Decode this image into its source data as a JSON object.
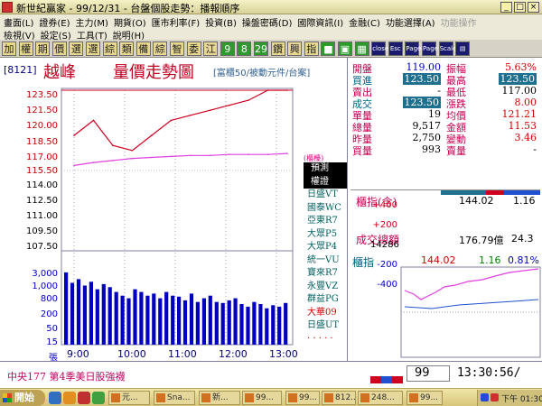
{
  "title": {
    "text": "新世紀贏家 - 99/12/31 - 台盤個股走勢：播報順序",
    "buttons": [
      "_",
      "□",
      "×"
    ]
  },
  "menu_row1": [
    {
      "label": "畫面(L)",
      "enabled": true
    },
    {
      "label": "證券(E)",
      "enabled": true
    },
    {
      "label": "主力(M)",
      "enabled": true
    },
    {
      "label": "期貨(O)",
      "enabled": true
    },
    {
      "label": "匯市利率(F)",
      "enabled": true
    },
    {
      "label": "投資(B)",
      "enabled": true
    },
    {
      "label": "操盤密碼(D)",
      "enabled": true
    },
    {
      "label": "國際資訊(I)",
      "enabled": true
    },
    {
      "label": "金融(C)",
      "enabled": true
    },
    {
      "label": "功能選擇(A)",
      "enabled": true
    },
    {
      "label": "功能操作",
      "enabled": false
    }
  ],
  "menu_row2": [
    {
      "label": "檢視(V)",
      "enabled": true
    },
    {
      "label": "設定(S)",
      "enabled": true
    },
    {
      "label": "工具(T)",
      "enabled": true
    },
    {
      "label": "說明(H)",
      "enabled": true
    }
  ],
  "toolbar": [
    {
      "label": "加",
      "style": "y"
    },
    {
      "label": "權",
      "style": "y"
    },
    {
      "label": "期",
      "style": "y"
    },
    {
      "label": "價",
      "style": "y"
    },
    {
      "label": "選",
      "style": "y"
    },
    {
      "label": "選",
      "style": "y"
    },
    {
      "label": "綜",
      "style": "y"
    },
    {
      "label": "類",
      "style": "y"
    },
    {
      "label": "備",
      "style": "y"
    },
    {
      "label": "綜",
      "style": "y"
    },
    {
      "label": "智",
      "style": "y"
    },
    {
      "label": "委",
      "style": "y"
    },
    {
      "label": "江",
      "style": "y"
    },
    {
      "label": "9",
      "style": "g"
    },
    {
      "label": "8",
      "style": "g"
    },
    {
      "label": "29",
      "style": "g"
    },
    {
      "label": "鑽",
      "style": "y"
    },
    {
      "label": "興",
      "style": "y"
    },
    {
      "label": "指",
      "style": "y"
    },
    {
      "label": "■",
      "style": "g"
    },
    {
      "label": "▣",
      "style": "g"
    },
    {
      "label": "▦",
      "style": "g"
    },
    {
      "label": "close",
      "style": "d"
    },
    {
      "label": "Esc",
      "style": "d"
    },
    {
      "label": "Page",
      "style": "d"
    },
    {
      "label": "Page",
      "style": "d"
    },
    {
      "label": "Scale",
      "style": "d"
    },
    {
      "label": "▤",
      "style": "d"
    }
  ],
  "header": {
    "code": "[8121]",
    "name": "越峰",
    "title": "量價走勢圖",
    "category": "[富櫃50/被動元件/台案]"
  },
  "price_axis": [
    "123.50",
    "121.50",
    "120.00",
    "118.50",
    "117.00",
    "115.50",
    "114.00",
    "112.50",
    "111.00",
    "109.50",
    "107.50"
  ],
  "volume_axis": [
    "3,000",
    "1,000",
    "800",
    "200",
    "50",
    "15",
    "張"
  ],
  "time_axis": [
    "9:00",
    "10:00",
    "11:00",
    "12:00",
    "13:00"
  ],
  "legend": {
    "note": "(櫃檯)",
    "items": [
      {
        "label": "預測",
        "style": "hl"
      },
      {
        "label": "權證",
        "style": "hl"
      },
      {
        "label": "日盛VT",
        "style": "normal"
      },
      {
        "label": "國泰WC",
        "style": "normal"
      },
      {
        "label": "亞東R7",
        "style": "normal"
      },
      {
        "label": "大眾P5",
        "style": "normal"
      },
      {
        "label": "大眾P4",
        "style": "normal"
      },
      {
        "label": "統一VU",
        "style": "normal"
      },
      {
        "label": "寶來R7",
        "style": "normal"
      },
      {
        "label": "永豐VZ",
        "style": "normal"
      },
      {
        "label": "群益PG",
        "style": "normal"
      },
      {
        "label": "大華09",
        "style": "red"
      },
      {
        "label": "日盛UT",
        "style": "normal"
      },
      {
        "label": "· · · · ·",
        "style": "red"
      }
    ]
  },
  "quote": {
    "rows": [
      {
        "l1": "開盤",
        "v1": "119.00",
        "c1": "c-blue",
        "l2": "振幅",
        "v2": "5.63%",
        "c2": "c-red"
      },
      {
        "l1": "買進",
        "v1": "123.50",
        "c1": "inv",
        "l2": "最高",
        "v2": "123.50",
        "c2": "inv"
      },
      {
        "l1": "賣出",
        "v1": "-",
        "c1": "c-blk",
        "l2": "最低",
        "v2": "117.00",
        "c2": "c-blk"
      },
      {
        "l1": "成交",
        "v1": "123.50",
        "c1": "inv",
        "l2": "漲跌",
        "v2": "8.00",
        "c2": "c-red"
      },
      {
        "l1": "單量",
        "v1": "19",
        "c1": "c-blk",
        "l2": "均價",
        "v2": "121.21",
        "c2": "c-red"
      },
      {
        "l1": "總量",
        "v1": "9,517",
        "c1": "c-blk",
        "l2": "金額",
        "v2": "11.53",
        "c2": "c-red"
      },
      {
        "l1": "昨量",
        "v1": "2,750",
        "c1": "c-blk",
        "l2": "變動",
        "v2": "3.46",
        "c2": "c-red"
      },
      {
        "l1": "買量",
        "v1": "993",
        "c1": "c-blk",
        "l2": "賣量",
        "v2": "-",
        "c2": "c-blk"
      }
    ]
  },
  "index_box": {
    "label1": "櫃指(含)",
    "value1": "144.02",
    "change1": "1.16",
    "label2": "成交總額",
    "value2": "176.79億",
    "change2": "24.3"
  },
  "mini_chart": {
    "title": "櫃指",
    "value": "144.02",
    "change": "1.16",
    "pct": "0.81%",
    "axis": [
      "+400",
      "+200",
      "14286",
      "-200",
      "-400"
    ]
  },
  "status": {
    "news": "中央177  第4季美日股強襪",
    "code_input": "99",
    "clock": "13:30:56/"
  },
  "taskbar": {
    "start": "開始",
    "tasks": [
      "元...",
      "Sna...",
      "新...",
      "99...",
      "99...",
      "812...",
      "248...",
      "99..."
    ],
    "time": "下午 01:30"
  },
  "colors": {
    "price_line": "#d00020",
    "avg_line": "#e040e0",
    "volume_bar": "#0000c0",
    "grid": "#a0a0c0",
    "accent_magenta": "#c00050"
  },
  "chart_data": {
    "type": "line",
    "title": "量價走勢圖",
    "xlabel": "",
    "ylabel": "",
    "ylim": [
      107.5,
      123.5
    ],
    "x": [
      "9:00",
      "10:00",
      "11:00",
      "12:00",
      "13:00"
    ],
    "series": [
      {
        "name": "price",
        "values": [
          119.0,
          120.5,
          118.0,
          117.5,
          119.0,
          120.5,
          121.0,
          121.5,
          122.0,
          122.5,
          123.5,
          123.5
        ]
      },
      {
        "name": "avg",
        "values": [
          116.0,
          116.3,
          116.5,
          116.7,
          116.8,
          116.9,
          117.0,
          117.0,
          117.1,
          117.1,
          117.1,
          117.2
        ]
      }
    ],
    "volume": [
      2500,
      800,
      1200,
      600,
      900,
      400,
      700,
      500,
      300,
      200,
      150,
      400,
      300,
      200,
      250,
      150,
      300,
      200,
      180,
      120,
      250,
      100,
      150,
      200,
      100,
      90,
      120,
      150,
      80,
      60,
      100,
      80,
      50,
      70,
      60,
      90
    ]
  }
}
